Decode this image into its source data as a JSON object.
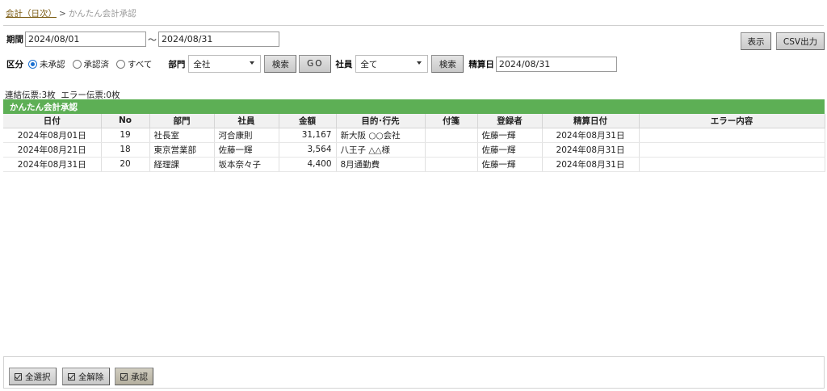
{
  "breadcrumb": {
    "link": "会計（日次）",
    "separator": ">",
    "current": "かんたん会計承認"
  },
  "period": {
    "label": "期間",
    "from": "2024/08/01",
    "tilde": "～",
    "to": "2024/08/31"
  },
  "actions": {
    "display": "表示",
    "csv": "CSV出力"
  },
  "filters": {
    "division_label": "区分",
    "radios": [
      {
        "label": "未承認",
        "checked": true
      },
      {
        "label": "承認済",
        "checked": false
      },
      {
        "label": "すべて",
        "checked": false
      }
    ],
    "dept_label": "部門",
    "dept_value": "全社",
    "search1": "検索",
    "go": "GO",
    "employee_label": "社員",
    "employee_value": "全て",
    "search2": "検索",
    "settle_label": "精算日",
    "settle_value": "2024/08/31"
  },
  "summary": "連結伝票:3枚  エラー伝票:0枚",
  "grid": {
    "title": "かんたん会計承認",
    "title_color": "#5daf55",
    "columns": [
      "日付",
      "No",
      "部門",
      "社員",
      "金額",
      "目的･行先",
      "付箋",
      "登録者",
      "精算日付",
      "エラー内容"
    ],
    "rows": [
      {
        "date": "2024年08月01日",
        "no": "19",
        "dept": "社長室",
        "employee": "河合康則",
        "amount": "31,167",
        "purpose": "新大阪 ○○会社",
        "tag": "",
        "registrant": "佐藤一輝",
        "settle_date": "2024年08月31日",
        "error": ""
      },
      {
        "date": "2024年08月21日",
        "no": "18",
        "dept": "東京営業部",
        "employee": "佐藤一輝",
        "amount": "3,564",
        "purpose": "八王子 △△様",
        "tag": "",
        "registrant": "佐藤一輝",
        "settle_date": "2024年08月31日",
        "error": ""
      },
      {
        "date": "2024年08月31日",
        "no": "20",
        "dept": "経理課",
        "employee": "坂本奈々子",
        "amount": "4,400",
        "purpose": "8月通勤費",
        "tag": "",
        "registrant": "佐藤一輝",
        "settle_date": "2024年08月31日",
        "error": ""
      }
    ]
  },
  "bottom": {
    "select_all": "全選択",
    "deselect_all": "全解除",
    "approve": "承認",
    "icon": "checkbox-icon"
  }
}
